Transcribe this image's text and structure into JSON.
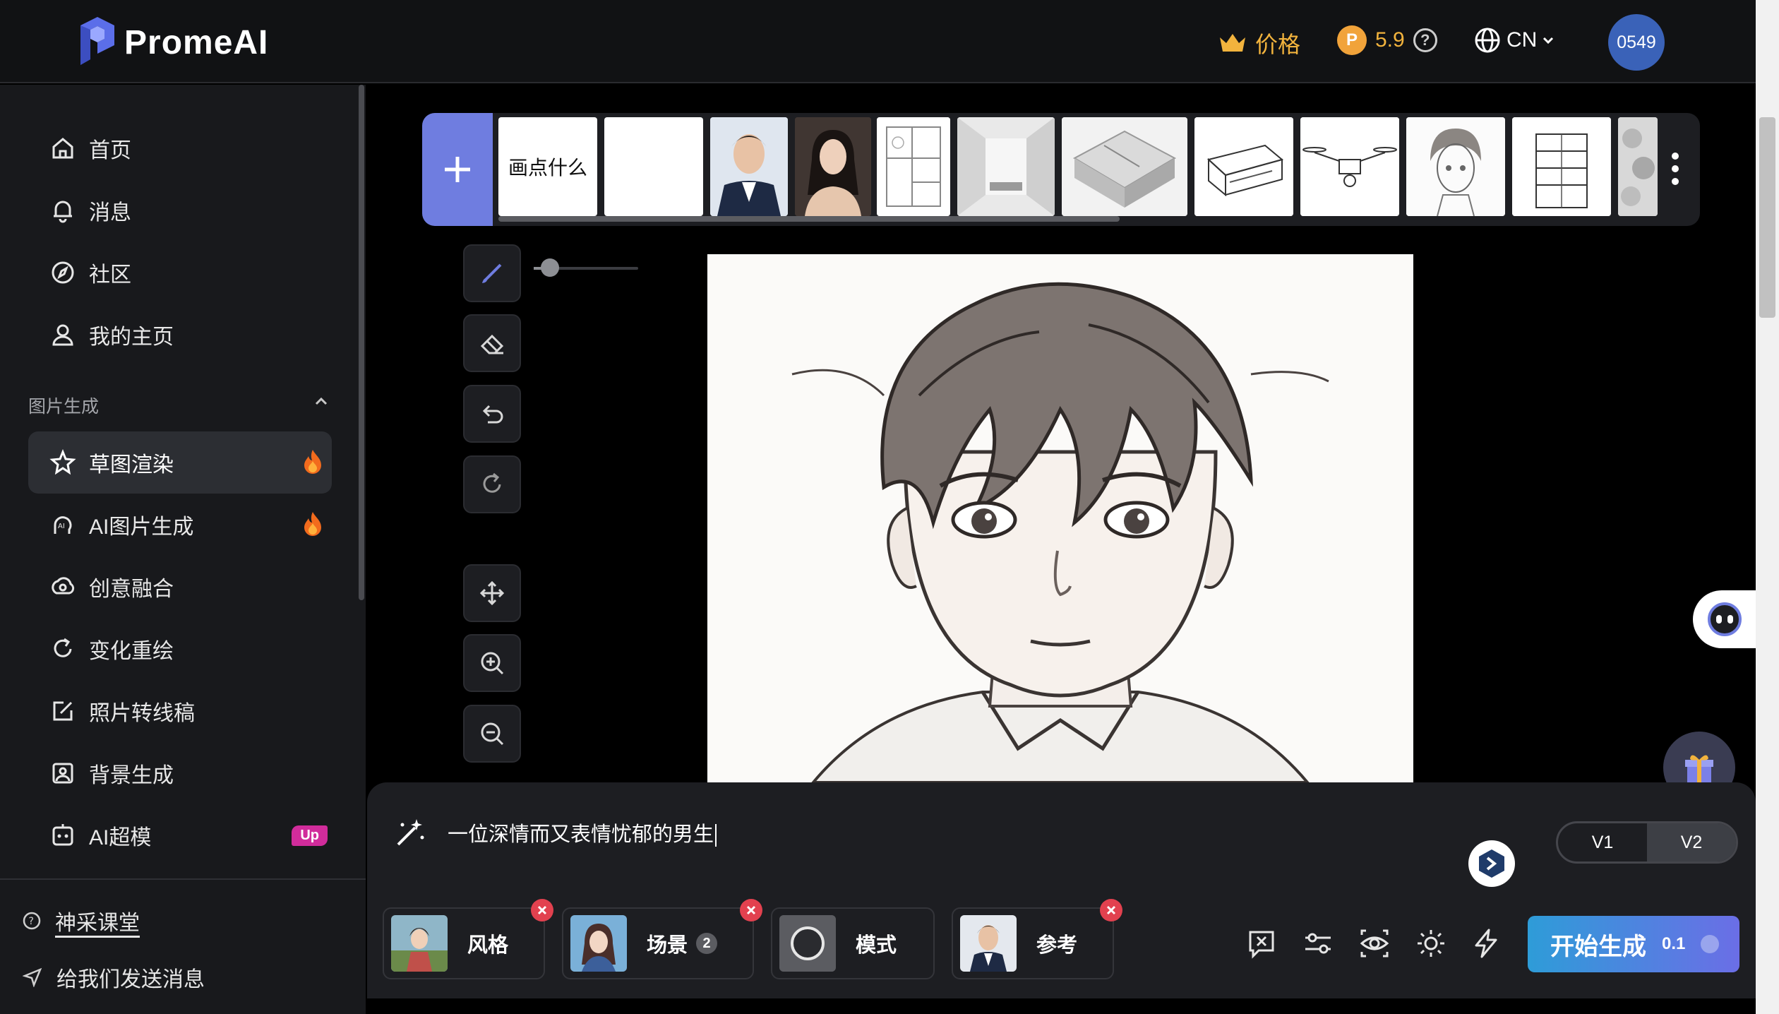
{
  "header": {
    "brand": "PromeAI",
    "price_label": "价格",
    "credits": "5.9",
    "help_mark": "?",
    "language": "CN",
    "avatar_text": "0549"
  },
  "sidebar": {
    "main_items": [
      {
        "label": "首页",
        "icon": "home-icon"
      },
      {
        "label": "消息",
        "icon": "bell-icon"
      },
      {
        "label": "社区",
        "icon": "compass-icon"
      },
      {
        "label": "我的主页",
        "icon": "user-icon"
      }
    ],
    "section_title": "图片生成",
    "tool_items": [
      {
        "label": "草图渲染",
        "icon": "sketch-icon",
        "active": true,
        "badge": "hot"
      },
      {
        "label": "AI图片生成",
        "icon": "ai-image-icon",
        "badge": "hot"
      },
      {
        "label": "创意融合",
        "icon": "blend-icon"
      },
      {
        "label": "变化重绘",
        "icon": "refresh-icon"
      },
      {
        "label": "照片转线稿",
        "icon": "edit-icon"
      },
      {
        "label": "背景生成",
        "icon": "image-icon"
      },
      {
        "label": "AI超模",
        "icon": "model-icon",
        "badge": "Up"
      }
    ],
    "footer": {
      "course": "神采课堂",
      "feedback": "给我们发送消息"
    }
  },
  "templates": {
    "first_label": "画点什么",
    "items": [
      "blank",
      "male-portrait-photo",
      "female-portrait-photo",
      "floor-plan-sketch",
      "interior-render",
      "isometric-room",
      "printer-sketch",
      "drone-sketch",
      "anime-boy-sketch",
      "building-sketch",
      "food-sketch"
    ]
  },
  "prompt": {
    "text": "一位深情而又表情忧郁的男生",
    "versions": [
      "V1",
      "V2"
    ],
    "selected_version": "V2"
  },
  "chips": [
    {
      "label": "风格",
      "removable": true
    },
    {
      "label": "场景",
      "count": "2",
      "removable": true
    },
    {
      "label": "模式",
      "removable": false
    },
    {
      "label": "参考",
      "removable": true
    }
  ],
  "generate": {
    "label": "开始生成",
    "cost": "0.1"
  },
  "colors": {
    "accent": "#6f7de0",
    "gold": "#f2b33d",
    "hot": "#f26b1d",
    "remove": "#e2414f",
    "up_badge": "#d12c9b"
  }
}
